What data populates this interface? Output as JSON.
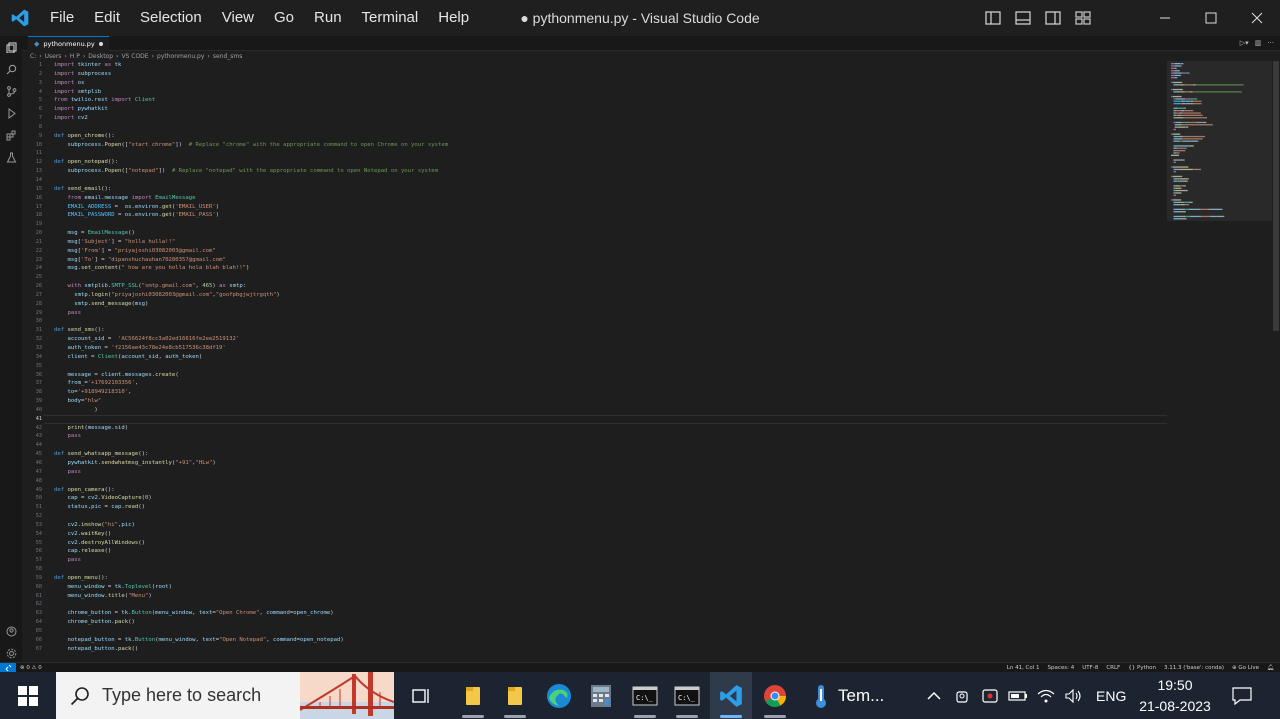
{
  "window": {
    "title": "● pythonmenu.py - Visual Studio Code",
    "menu": [
      "File",
      "Edit",
      "Selection",
      "View",
      "Go",
      "Run",
      "Terminal",
      "Help"
    ]
  },
  "tab": {
    "label": "pythonmenu.py"
  },
  "breadcrumb": [
    "C:",
    "Users",
    "H P",
    "Desktop",
    "VS CODE",
    "pythonmenu.py",
    "send_sms"
  ],
  "editor": {
    "current_line": 41,
    "lines": [
      [
        [
          "k",
          "import"
        ],
        [
          "v",
          " tkinter "
        ],
        [
          "k",
          "as"
        ],
        [
          "v",
          " tk"
        ]
      ],
      [
        [
          "k",
          "import"
        ],
        [
          "v",
          " subprocess"
        ]
      ],
      [
        [
          "k",
          "import"
        ],
        [
          "v",
          " os"
        ]
      ],
      [
        [
          "k",
          "import"
        ],
        [
          "v",
          " smtplib"
        ]
      ],
      [
        [
          "k",
          "from"
        ],
        [
          "v",
          " twilio.rest "
        ],
        [
          "k",
          "import"
        ],
        [
          "m",
          " Client"
        ]
      ],
      [
        [
          "k",
          "import"
        ],
        [
          "v",
          " pywhatkit"
        ]
      ],
      [
        [
          "k",
          "import"
        ],
        [
          "v",
          " cv2"
        ]
      ],
      [],
      [
        [
          "kd",
          "def"
        ],
        [
          "f",
          " open_chrome"
        ],
        [
          "p",
          "():"
        ]
      ],
      [
        [
          "p",
          "    "
        ],
        [
          "v",
          "subprocess"
        ],
        [
          "p",
          "."
        ],
        [
          "f",
          "Popen"
        ],
        [
          "p",
          "(["
        ],
        [
          "s",
          "\"start chrome\""
        ],
        [
          "p",
          "])  "
        ],
        [
          "c",
          "# Replace \"chrome\" with the appropriate command to open Chrome on your system"
        ]
      ],
      [],
      [
        [
          "kd",
          "def"
        ],
        [
          "f",
          " open_notepad"
        ],
        [
          "p",
          "():"
        ]
      ],
      [
        [
          "p",
          "    "
        ],
        [
          "v",
          "subprocess"
        ],
        [
          "p",
          "."
        ],
        [
          "f",
          "Popen"
        ],
        [
          "p",
          "(["
        ],
        [
          "s",
          "\"notepad\""
        ],
        [
          "p",
          "])  "
        ],
        [
          "c",
          "# Replace \"notepad\" with the appropriate command to open Notepad on your system"
        ]
      ],
      [],
      [
        [
          "kd",
          "def"
        ],
        [
          "f",
          " send_email"
        ],
        [
          "p",
          "():"
        ]
      ],
      [
        [
          "p",
          "    "
        ],
        [
          "k",
          "from"
        ],
        [
          "v",
          " email.message "
        ],
        [
          "k",
          "import"
        ],
        [
          "m",
          " EmailMessage"
        ]
      ],
      [
        [
          "p",
          "    "
        ],
        [
          "cst",
          "EMAIL_ADDRESS"
        ],
        [
          "p",
          " =  "
        ],
        [
          "v",
          "os"
        ],
        [
          "p",
          "."
        ],
        [
          "v",
          "environ"
        ],
        [
          "p",
          "."
        ],
        [
          "f",
          "get"
        ],
        [
          "p",
          "("
        ],
        [
          "s",
          "'EMAIL_USER'"
        ],
        [
          "p",
          ")"
        ]
      ],
      [
        [
          "p",
          "    "
        ],
        [
          "cst",
          "EMAIL_PASSWORD"
        ],
        [
          "p",
          " = "
        ],
        [
          "v",
          "os"
        ],
        [
          "p",
          "."
        ],
        [
          "v",
          "environ"
        ],
        [
          "p",
          "."
        ],
        [
          "f",
          "get"
        ],
        [
          "p",
          "("
        ],
        [
          "s",
          "'EMAIL_PASS'"
        ],
        [
          "p",
          ")"
        ]
      ],
      [],
      [
        [
          "p",
          "    "
        ],
        [
          "v",
          "msg"
        ],
        [
          "p",
          " = "
        ],
        [
          "m",
          "EmailMessage"
        ],
        [
          "p",
          "()"
        ]
      ],
      [
        [
          "p",
          "    "
        ],
        [
          "v",
          "msg"
        ],
        [
          "p",
          "["
        ],
        [
          "s",
          "'Subject'"
        ],
        [
          "p",
          "] = "
        ],
        [
          "s",
          "\"holla hulla!!\""
        ]
      ],
      [
        [
          "p",
          "    "
        ],
        [
          "v",
          "msg"
        ],
        [
          "p",
          "["
        ],
        [
          "s",
          "'From'"
        ],
        [
          "p",
          "] = "
        ],
        [
          "s",
          "\"priyajoshi03082003@gmail.com\""
        ]
      ],
      [
        [
          "p",
          "    "
        ],
        [
          "v",
          "msg"
        ],
        [
          "p",
          "["
        ],
        [
          "s",
          "'To'"
        ],
        [
          "p",
          "] = "
        ],
        [
          "s",
          "\"dipanshuchauhan70280357@gmail.com\""
        ]
      ],
      [
        [
          "p",
          "    "
        ],
        [
          "v",
          "msg"
        ],
        [
          "p",
          "."
        ],
        [
          "f",
          "set_content"
        ],
        [
          "p",
          "("
        ],
        [
          "s",
          "\" how are you holla hola blah blah!!\""
        ],
        [
          "p",
          ")"
        ]
      ],
      [],
      [
        [
          "p",
          "    "
        ],
        [
          "k",
          "with"
        ],
        [
          "v",
          " smtplib"
        ],
        [
          "p",
          "."
        ],
        [
          "m",
          "SMTP_SSL"
        ],
        [
          "p",
          "("
        ],
        [
          "s",
          "\"smtp.gmail.com\""
        ],
        [
          "p",
          ", "
        ],
        [
          "n",
          "465"
        ],
        [
          "p",
          ") "
        ],
        [
          "k",
          "as"
        ],
        [
          "v",
          " smtp"
        ],
        [
          "p",
          ":"
        ]
      ],
      [
        [
          "p",
          "      "
        ],
        [
          "v",
          "smtp"
        ],
        [
          "p",
          "."
        ],
        [
          "f",
          "login"
        ],
        [
          "p",
          "("
        ],
        [
          "s",
          "\"priyajoshi03082003@gmail.com\""
        ],
        [
          "p",
          ","
        ],
        [
          "s",
          "\"goofpbgjwjtrgqth\""
        ],
        [
          "p",
          ")"
        ]
      ],
      [
        [
          "p",
          "      "
        ],
        [
          "v",
          "smtp"
        ],
        [
          "p",
          "."
        ],
        [
          "f",
          "send_message"
        ],
        [
          "p",
          "("
        ],
        [
          "v",
          "msg"
        ],
        [
          "p",
          ")"
        ]
      ],
      [
        [
          "p",
          "    "
        ],
        [
          "k",
          "pass"
        ]
      ],
      [],
      [
        [
          "kd",
          "def"
        ],
        [
          "f",
          " send_sms"
        ],
        [
          "p",
          "():"
        ]
      ],
      [
        [
          "p",
          "    "
        ],
        [
          "v",
          "account_sid"
        ],
        [
          "p",
          " =  "
        ],
        [
          "s",
          "'AC56624f8cc3a02ed16616fe2ee2519132'"
        ]
      ],
      [
        [
          "p",
          "    "
        ],
        [
          "v",
          "auth_token"
        ],
        [
          "p",
          " = "
        ],
        [
          "s",
          "'f2156ae43c78e24e8cb517536c38df19'"
        ]
      ],
      [
        [
          "p",
          "    "
        ],
        [
          "v",
          "client"
        ],
        [
          "p",
          " = "
        ],
        [
          "m",
          "Client"
        ],
        [
          "p",
          "("
        ],
        [
          "v",
          "account_sid"
        ],
        [
          "p",
          ", "
        ],
        [
          "v",
          "auth_token"
        ],
        [
          "p",
          ")"
        ]
      ],
      [],
      [
        [
          "p",
          "    "
        ],
        [
          "v",
          "message"
        ],
        [
          "p",
          " = "
        ],
        [
          "v",
          "client"
        ],
        [
          "p",
          "."
        ],
        [
          "v",
          "messages"
        ],
        [
          "p",
          "."
        ],
        [
          "f",
          "create"
        ],
        [
          "p",
          "("
        ]
      ],
      [
        [
          "p",
          "    "
        ],
        [
          "v",
          "from_"
        ],
        [
          "p",
          "="
        ],
        [
          "s",
          "'+17692103356'"
        ],
        [
          "p",
          ","
        ]
      ],
      [
        [
          "p",
          "    "
        ],
        [
          "v",
          "to"
        ],
        [
          "p",
          "="
        ],
        [
          "s",
          "'+918949218310'"
        ],
        [
          "p",
          ","
        ]
      ],
      [
        [
          "p",
          "    "
        ],
        [
          "v",
          "body"
        ],
        [
          "p",
          "="
        ],
        [
          "s",
          "\"hlw\""
        ]
      ],
      [
        [
          "p",
          "            )"
        ]
      ],
      [],
      [
        [
          "p",
          "    "
        ],
        [
          "f",
          "print"
        ],
        [
          "p",
          "("
        ],
        [
          "v",
          "message"
        ],
        [
          "p",
          "."
        ],
        [
          "v",
          "sid"
        ],
        [
          "p",
          ")"
        ]
      ],
      [
        [
          "p",
          "    "
        ],
        [
          "k",
          "pass"
        ]
      ],
      [],
      [
        [
          "kd",
          "def"
        ],
        [
          "f",
          " send_whatsapp_message"
        ],
        [
          "p",
          "():"
        ]
      ],
      [
        [
          "p",
          "    "
        ],
        [
          "v",
          "pywhatkit"
        ],
        [
          "p",
          "."
        ],
        [
          "f",
          "sendwhatmsg_instantly"
        ],
        [
          "p",
          "("
        ],
        [
          "s",
          "\"+91\""
        ],
        [
          "p",
          ","
        ],
        [
          "s",
          "\"HLw\""
        ],
        [
          "p",
          ")"
        ]
      ],
      [
        [
          "p",
          "    "
        ],
        [
          "k",
          "pass"
        ]
      ],
      [],
      [
        [
          "kd",
          "def"
        ],
        [
          "f",
          " open_camera"
        ],
        [
          "p",
          "():"
        ]
      ],
      [
        [
          "p",
          "    "
        ],
        [
          "v",
          "cap"
        ],
        [
          "p",
          " = "
        ],
        [
          "v",
          "cv2"
        ],
        [
          "p",
          "."
        ],
        [
          "f",
          "VideoCapture"
        ],
        [
          "p",
          "("
        ],
        [
          "n",
          "0"
        ],
        [
          "p",
          ")"
        ]
      ],
      [
        [
          "p",
          "    "
        ],
        [
          "v",
          "status"
        ],
        [
          "p",
          ","
        ],
        [
          "v",
          "pic"
        ],
        [
          "p",
          " = "
        ],
        [
          "v",
          "cap"
        ],
        [
          "p",
          "."
        ],
        [
          "f",
          "read"
        ],
        [
          "p",
          "()"
        ]
      ],
      [],
      [
        [
          "p",
          "    "
        ],
        [
          "v",
          "cv2"
        ],
        [
          "p",
          "."
        ],
        [
          "f",
          "imshow"
        ],
        [
          "p",
          "("
        ],
        [
          "s",
          "\"hi\""
        ],
        [
          "p",
          ","
        ],
        [
          "v",
          "pic"
        ],
        [
          "p",
          ")"
        ]
      ],
      [
        [
          "p",
          "    "
        ],
        [
          "v",
          "cv2"
        ],
        [
          "p",
          "."
        ],
        [
          "f",
          "waitKey"
        ],
        [
          "p",
          "()"
        ]
      ],
      [
        [
          "p",
          "    "
        ],
        [
          "v",
          "cv2"
        ],
        [
          "p",
          "."
        ],
        [
          "f",
          "destroyAllWindows"
        ],
        [
          "p",
          "()"
        ]
      ],
      [
        [
          "p",
          "    "
        ],
        [
          "v",
          "cap"
        ],
        [
          "p",
          "."
        ],
        [
          "f",
          "release"
        ],
        [
          "p",
          "()"
        ]
      ],
      [
        [
          "p",
          "    "
        ],
        [
          "k",
          "pass"
        ]
      ],
      [],
      [
        [
          "kd",
          "def"
        ],
        [
          "f",
          " open_menu"
        ],
        [
          "p",
          "():"
        ]
      ],
      [
        [
          "p",
          "    "
        ],
        [
          "v",
          "menu_window"
        ],
        [
          "p",
          " = "
        ],
        [
          "v",
          "tk"
        ],
        [
          "p",
          "."
        ],
        [
          "m",
          "Toplevel"
        ],
        [
          "p",
          "("
        ],
        [
          "v",
          "root"
        ],
        [
          "p",
          ")"
        ]
      ],
      [
        [
          "p",
          "    "
        ],
        [
          "v",
          "menu_window"
        ],
        [
          "p",
          "."
        ],
        [
          "f",
          "title"
        ],
        [
          "p",
          "("
        ],
        [
          "s",
          "\"Menu\""
        ],
        [
          "p",
          ")"
        ]
      ],
      [],
      [
        [
          "p",
          "    "
        ],
        [
          "v",
          "chrome_button"
        ],
        [
          "p",
          " = "
        ],
        [
          "v",
          "tk"
        ],
        [
          "p",
          "."
        ],
        [
          "m",
          "Button"
        ],
        [
          "p",
          "("
        ],
        [
          "v",
          "menu_window"
        ],
        [
          "p",
          ", "
        ],
        [
          "v",
          "text"
        ],
        [
          "p",
          "="
        ],
        [
          "s",
          "\"Open Chrome\""
        ],
        [
          "p",
          ", "
        ],
        [
          "v",
          "command"
        ],
        [
          "p",
          "="
        ],
        [
          "v",
          "open_chrome"
        ],
        [
          "p",
          ")"
        ]
      ],
      [
        [
          "p",
          "    "
        ],
        [
          "v",
          "chrome_button"
        ],
        [
          "p",
          "."
        ],
        [
          "f",
          "pack"
        ],
        [
          "p",
          "()"
        ]
      ],
      [],
      [
        [
          "p",
          "    "
        ],
        [
          "v",
          "notepad_button"
        ],
        [
          "p",
          " = "
        ],
        [
          "v",
          "tk"
        ],
        [
          "p",
          "."
        ],
        [
          "m",
          "Button"
        ],
        [
          "p",
          "("
        ],
        [
          "v",
          "menu_window"
        ],
        [
          "p",
          ", "
        ],
        [
          "v",
          "text"
        ],
        [
          "p",
          "="
        ],
        [
          "s",
          "\"Open Notepad\""
        ],
        [
          "p",
          ", "
        ],
        [
          "v",
          "command"
        ],
        [
          "p",
          "="
        ],
        [
          "v",
          "open_notepad"
        ],
        [
          "p",
          ")"
        ]
      ],
      [
        [
          "p",
          "    "
        ],
        [
          "v",
          "notepad_button"
        ],
        [
          "p",
          "."
        ],
        [
          "f",
          "pack"
        ],
        [
          "p",
          "()"
        ]
      ]
    ]
  },
  "statusbar": {
    "problems": "⊗ 0 ⚠ 0",
    "right": [
      "Ln 41, Col 1",
      "Spaces: 4",
      "UTF-8",
      "CRLF",
      "{} Python",
      "3.11.3 ('base': conda)",
      "⊕ Go Live"
    ]
  },
  "taskbar": {
    "search_placeholder": "Type here to search",
    "weather": "Tem...",
    "language": "ENG",
    "time": "19:50",
    "date": "21-08-2023"
  },
  "colors": {
    "accent": "#0078d4",
    "taskbar": "#1c2431",
    "editor_bg": "#1e1e1e"
  }
}
